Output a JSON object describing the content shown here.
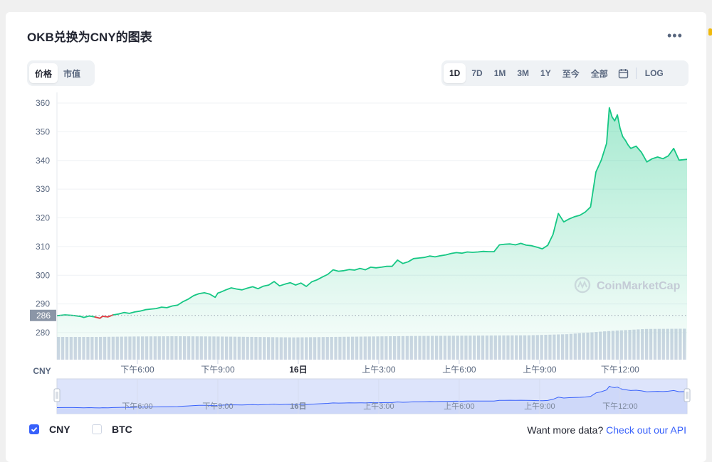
{
  "header": {
    "title": "OKB兑换为CNY的图表",
    "more_icon": "more-horizontal-icon"
  },
  "left_toggle": {
    "items": [
      "价格",
      "市值"
    ],
    "active": 0
  },
  "range_toggle": {
    "items": [
      "1D",
      "7D",
      "1M",
      "3M",
      "1Y",
      "至今",
      "全部"
    ],
    "active": 0,
    "calendar_icon": "calendar-icon",
    "log_label": "LOG"
  },
  "watermark": {
    "text": "CoinMarketCap",
    "icon": "coinmarketcap-logo-icon"
  },
  "legend": {
    "cny_label": "CNY",
    "btc_label": "BTC",
    "cny_checked": true,
    "btc_checked": false
  },
  "api_text": {
    "prefix": "Want more data? ",
    "link": "Check out our API"
  },
  "colors": {
    "line": "#16c784",
    "negative": "#ea3943",
    "volume": "#cfd6e4",
    "navigator_line": "#3861fb",
    "navigator_fill": "#dde4fb"
  },
  "chart_data": {
    "type": "area",
    "currency_label": "CNY",
    "ylim": [
      275,
      362
    ],
    "y_ticks": [
      280,
      290,
      300,
      310,
      320,
      330,
      340,
      350,
      360
    ],
    "xlim": [
      0,
      23.5
    ],
    "x_ticks": [
      {
        "hours": 3,
        "label": "下午6:00"
      },
      {
        "hours": 6,
        "label": "下午9:00"
      },
      {
        "hours": 9,
        "label": "16日",
        "bold": true
      },
      {
        "hours": 12,
        "label": "上午3:00"
      },
      {
        "hours": 15,
        "label": "上午6:00"
      },
      {
        "hours": 18,
        "label": "上午9:00"
      },
      {
        "hours": 21,
        "label": "下午12:00"
      }
    ],
    "baseline": {
      "value": 286,
      "label": "286"
    },
    "series": [
      {
        "name": "CNY",
        "x": [
          0,
          0.3,
          0.6,
          0.9,
          1.0,
          1.2,
          1.4,
          1.6,
          1.7,
          1.9,
          2.1,
          2.3,
          2.5,
          2.7,
          2.9,
          3.1,
          3.3,
          3.5,
          3.7,
          3.9,
          4.1,
          4.3,
          4.5,
          4.7,
          4.9,
          5.1,
          5.3,
          5.5,
          5.7,
          5.9,
          6.0,
          6.1,
          6.3,
          6.5,
          6.7,
          6.9,
          7.1,
          7.3,
          7.5,
          7.7,
          7.9,
          8.1,
          8.3,
          8.5,
          8.7,
          8.9,
          9.1,
          9.3,
          9.5,
          9.7,
          9.9,
          10.1,
          10.3,
          10.5,
          10.7,
          10.9,
          11.1,
          11.3,
          11.5,
          11.7,
          11.9,
          12.1,
          12.3,
          12.5,
          12.7,
          12.9,
          13.1,
          13.3,
          13.5,
          13.7,
          13.9,
          14.1,
          14.3,
          14.5,
          14.7,
          14.9,
          15.1,
          15.3,
          15.5,
          15.7,
          15.9,
          16.1,
          16.3,
          16.5,
          16.7,
          16.9,
          17.1,
          17.3,
          17.5,
          17.7,
          17.9,
          18.1,
          18.3,
          18.5,
          18.7,
          18.9,
          19.1,
          19.3,
          19.5,
          19.7,
          19.9,
          20.1,
          20.3,
          20.5,
          20.6,
          20.7,
          20.8,
          20.9,
          21.0,
          21.1,
          21.2,
          21.3,
          21.4,
          21.6,
          21.8,
          22.0,
          22.2,
          22.4,
          22.6,
          22.8,
          23.0,
          23.2,
          23.5
        ],
        "values": [
          285.9,
          286.2,
          286.0,
          285.6,
          285.3,
          285.8,
          285.5,
          285.0,
          285.7,
          285.5,
          286.2,
          286.5,
          287.0,
          286.7,
          287.2,
          287.5,
          288.0,
          288.2,
          288.4,
          288.9,
          288.7,
          289.3,
          289.6,
          290.8,
          291.7,
          292.9,
          293.6,
          293.9,
          293.4,
          292.3,
          293.8,
          294.1,
          294.9,
          295.6,
          295.2,
          294.9,
          295.5,
          296.0,
          295.3,
          296.2,
          296.6,
          297.8,
          296.3,
          296.9,
          297.4,
          296.6,
          297.3,
          296.1,
          297.7,
          298.4,
          299.4,
          300.3,
          301.9,
          301.4,
          301.6,
          302.0,
          301.8,
          302.4,
          301.9,
          302.8,
          302.6,
          302.8,
          303.1,
          303.1,
          305.3,
          304.1,
          304.7,
          305.8,
          306.0,
          306.2,
          306.7,
          306.4,
          306.8,
          307.1,
          307.6,
          307.9,
          307.7,
          308.1,
          308.0,
          308.1,
          308.3,
          308.2,
          308.2,
          310.6,
          310.8,
          310.9,
          310.6,
          311.1,
          310.5,
          310.3,
          309.8,
          309.2,
          310.4,
          314.2,
          321.5,
          318.6,
          319.6,
          320.4,
          320.9,
          322.0,
          323.8,
          336.0,
          340.1,
          346.0,
          358.4,
          355.2,
          353.8,
          355.9,
          351.2,
          348.3,
          347.0,
          345.4,
          344.2,
          345.0,
          342.8,
          339.5,
          340.6,
          341.2,
          340.6,
          341.6,
          344.2,
          340.1,
          340.4
        ],
        "negative_x_range": [
          1.4,
          2.2
        ]
      }
    ],
    "volume": {
      "x_start": 0,
      "x_end": 23.5,
      "bars": 150,
      "levels": [
        1.0,
        1.0,
        1.02,
        1.03,
        1.02,
        1.0,
        0.98,
        1.0,
        1.02,
        1.04,
        1.05,
        1.06,
        1.07,
        1.12,
        1.25,
        1.35,
        1.36
      ]
    },
    "navigator": {
      "x_ticks": [
        "下午6:00",
        "下午9:00",
        "16日",
        "上午3:00",
        "上午6:00",
        "上午9:00",
        "下午12:00"
      ]
    }
  }
}
